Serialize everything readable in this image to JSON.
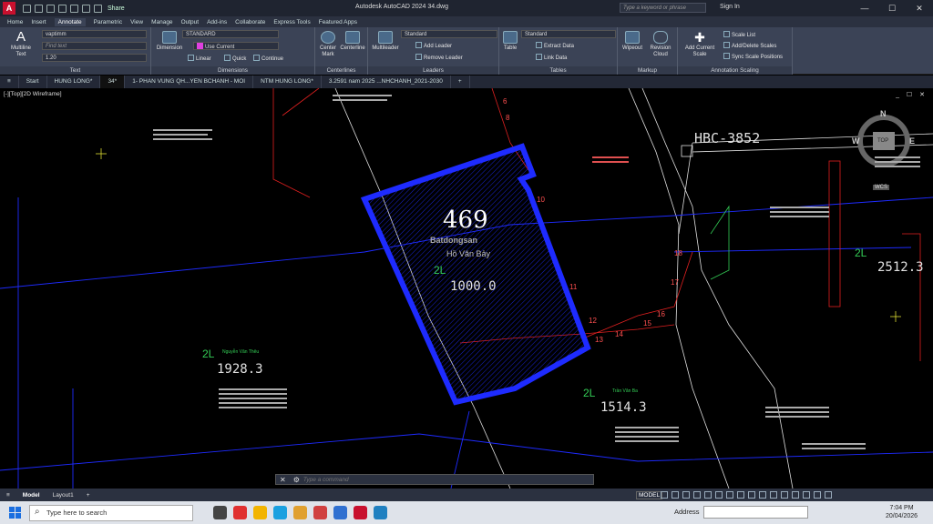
{
  "titlebar": {
    "logo": "A",
    "share": "Share",
    "title": "Autodesk AutoCAD 2024   34.dwg",
    "search_placeholder": "Type a keyword or phrase",
    "signin": "Sign In",
    "min": "—",
    "max": "☐",
    "close": "✕"
  },
  "ribbon_tabs": [
    "Home",
    "Insert",
    "Annotate",
    "Parametric",
    "View",
    "Manage",
    "Output",
    "Add-ins",
    "Collaborate",
    "Express Tools",
    "Featured Apps"
  ],
  "ribbon": {
    "text_group": {
      "multiline_label": "Multiline Text",
      "font_value": "vaptimm",
      "find_placeholder": "Find text",
      "height_value": "1.20",
      "group_label": "Text"
    },
    "dimensions_group": {
      "style_value": "STANDARD",
      "layer_value": "Use Current",
      "dimension_label": "Dimension",
      "linear_label": "Linear",
      "quick_label": "Quick",
      "continue_label": "Continue",
      "group_label": "Dimensions"
    },
    "centerlines_group": {
      "center_mark": "Center Mark",
      "centerline": "Centerline",
      "group_label": "Centerlines"
    },
    "leaders_group": {
      "multileader": "Multileader",
      "style_value": "Standard",
      "add_leader": "Add Leader",
      "remove_leader": "Remove Leader",
      "group_label": "Leaders"
    },
    "tables_group": {
      "table": "Table",
      "style_value": "Standard",
      "extract_data": "Extract Data",
      "link_data": "Link Data",
      "group_label": "Tables"
    },
    "markup_group": {
      "wipeout": "Wipeout",
      "revision_cloud": "Revision Cloud",
      "group_label": "Markup"
    },
    "scaling_group": {
      "add_current_scale": "Add Current Scale",
      "scale_list": "Scale List",
      "add_delete_scales": "Add/Delete Scales",
      "sync_scale_positions": "Sync Scale Positions",
      "group_label": "Annotation Scaling"
    }
  },
  "file_tabs": [
    "Start",
    "HUNG LONG*",
    "34*",
    "1- PHAN VUNG QH...YEN BCHANH - MOI",
    "NTM HUNG LONG*",
    "3.2591 nam 2025 ...NHCHANH_2021-2030",
    "+"
  ],
  "viewport": {
    "label": "[-][Top][2D Wireframe]",
    "controls": "_ ☐ ✕",
    "parcel_number": "469",
    "parcel_owner": "Hồ Văn Bảy",
    "parcel_code": "2L",
    "parcel_area": "1000.0",
    "watermark": "Batdongsan",
    "road_label": "HBC-3852",
    "left_code": "2L",
    "left_area": "1928.3",
    "left_owner": "Nguyễn Văn Thêu",
    "mid_code": "2L",
    "mid_area": "1514.3",
    "mid_owner": "Trần Văn Ba",
    "right_code": "2L",
    "right_area": "2512.3",
    "vertex_labels": [
      "10",
      "11",
      "12",
      "13",
      "14",
      "15",
      "16",
      "17",
      "18",
      "6",
      "8"
    ],
    "compass": {
      "n": "N",
      "w": "W",
      "e": "E",
      "top": "TOP",
      "wcs": "WCS"
    }
  },
  "cmdline": {
    "close": "✕",
    "placeholder": "Type a command"
  },
  "statusbar": {
    "tabs": [
      "≡",
      "Model",
      "Layout1",
      "+"
    ],
    "model_btn": "MODEL"
  },
  "taskbar": {
    "search": "Type here to search",
    "address": "Address",
    "time": "7:04 PM",
    "date": "20/04/2026"
  },
  "colors": {
    "parcel": "#1e2bff",
    "red_lines": "#e02020",
    "white_lines": "#e0e0e0",
    "green": "#33cc55"
  }
}
